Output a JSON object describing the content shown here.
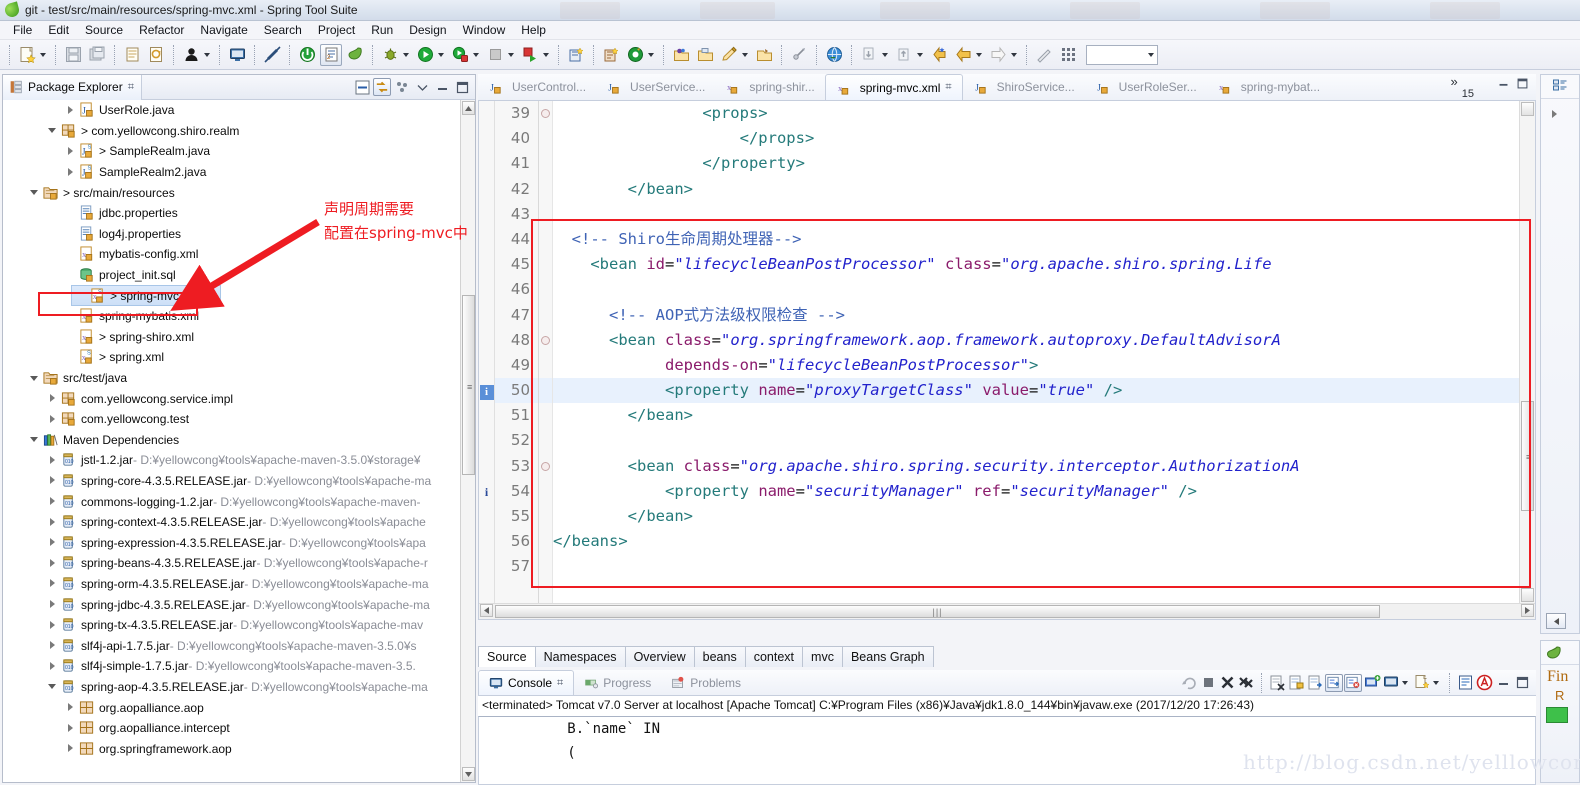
{
  "window": {
    "title": "git - test/src/main/resources/spring-mvc.xml - Spring Tool Suite",
    "app_icon": "sts-leaf-icon"
  },
  "menubar": {
    "items": [
      {
        "label": "File"
      },
      {
        "label": "Edit"
      },
      {
        "label": "Source"
      },
      {
        "label": "Refactor"
      },
      {
        "label": "Navigate"
      },
      {
        "label": "Search"
      },
      {
        "label": "Project"
      },
      {
        "label": "Run"
      },
      {
        "label": "Design"
      },
      {
        "label": "Window"
      },
      {
        "label": "Help"
      }
    ]
  },
  "toolbar": {
    "combo_value": ""
  },
  "package_explorer": {
    "tab_label": "Package Explorer",
    "close_glyph": "⌗",
    "tree": [
      {
        "indent": 3,
        "twisty": "collapsed",
        "icon": "java-file-icon",
        "label": "UserRole.java",
        "path": ""
      },
      {
        "indent": 2,
        "twisty": "expanded",
        "icon": "package-icon",
        "label": "> com.yellowcong.shiro.realm",
        "path": ""
      },
      {
        "indent": 3,
        "twisty": "collapsed",
        "icon": "java-class-icon",
        "label": "> SampleRealm.java",
        "path": ""
      },
      {
        "indent": 3,
        "twisty": "collapsed",
        "icon": "java-class-icon",
        "label": "SampleRealm2.java",
        "path": ""
      },
      {
        "indent": 1,
        "twisty": "expanded",
        "icon": "src-folder-icon",
        "label": "> src/main/resources",
        "path": ""
      },
      {
        "indent": 3,
        "twisty": "none",
        "icon": "props-file-icon",
        "label": "jdbc.properties",
        "path": ""
      },
      {
        "indent": 3,
        "twisty": "none",
        "icon": "props-file-icon",
        "label": "log4j.properties",
        "path": ""
      },
      {
        "indent": 3,
        "twisty": "none",
        "icon": "xml-file-icon",
        "label": "mybatis-config.xml",
        "path": ""
      },
      {
        "indent": 3,
        "twisty": "none",
        "icon": "sql-file-icon",
        "label": "project_init.sql",
        "path": ""
      },
      {
        "indent": 3,
        "twisty": "none",
        "icon": "spring-xml-icon",
        "label": "> spring-mvc.xml",
        "path": "",
        "selected": true
      },
      {
        "indent": 3,
        "twisty": "none",
        "icon": "xml-file-icon",
        "label": "spring-mybatis.xml",
        "path": ""
      },
      {
        "indent": 3,
        "twisty": "none",
        "icon": "xml-file-icon",
        "label": "> spring-shiro.xml",
        "path": ""
      },
      {
        "indent": 3,
        "twisty": "none",
        "icon": "spring-xml-icon",
        "label": "> spring.xml",
        "path": ""
      },
      {
        "indent": 1,
        "twisty": "expanded",
        "icon": "src-folder-icon",
        "label": "src/test/java",
        "path": ""
      },
      {
        "indent": 2,
        "twisty": "collapsed",
        "icon": "package-icon",
        "label": "com.yellowcong.service.impl",
        "path": ""
      },
      {
        "indent": 2,
        "twisty": "collapsed",
        "icon": "package-icon",
        "label": "com.yellowcong.test",
        "path": ""
      },
      {
        "indent": 1,
        "twisty": "expanded",
        "icon": "library-icon",
        "label": "Maven Dependencies",
        "path": ""
      },
      {
        "indent": 2,
        "twisty": "collapsed",
        "icon": "jar-icon",
        "label": "jstl-1.2.jar",
        "path": " - D:¥yellowcong¥tools¥apache-maven-3.5.0¥storage¥"
      },
      {
        "indent": 2,
        "twisty": "collapsed",
        "icon": "jar-icon",
        "label": "spring-core-4.3.5.RELEASE.jar",
        "path": " - D:¥yellowcong¥tools¥apache-ma"
      },
      {
        "indent": 2,
        "twisty": "collapsed",
        "icon": "jar-icon",
        "label": "commons-logging-1.2.jar",
        "path": " - D:¥yellowcong¥tools¥apache-maven-"
      },
      {
        "indent": 2,
        "twisty": "collapsed",
        "icon": "jar-icon",
        "label": "spring-context-4.3.5.RELEASE.jar",
        "path": " - D:¥yellowcong¥tools¥apache"
      },
      {
        "indent": 2,
        "twisty": "collapsed",
        "icon": "jar-icon",
        "label": "spring-expression-4.3.5.RELEASE.jar",
        "path": " - D:¥yellowcong¥tools¥apa"
      },
      {
        "indent": 2,
        "twisty": "collapsed",
        "icon": "jar-icon",
        "label": "spring-beans-4.3.5.RELEASE.jar",
        "path": " - D:¥yellowcong¥tools¥apache-r"
      },
      {
        "indent": 2,
        "twisty": "collapsed",
        "icon": "jar-icon",
        "label": "spring-orm-4.3.5.RELEASE.jar",
        "path": " - D:¥yellowcong¥tools¥apache-ma"
      },
      {
        "indent": 2,
        "twisty": "collapsed",
        "icon": "jar-icon",
        "label": "spring-jdbc-4.3.5.RELEASE.jar",
        "path": " - D:¥yellowcong¥tools¥apache-ma"
      },
      {
        "indent": 2,
        "twisty": "collapsed",
        "icon": "jar-icon",
        "label": "spring-tx-4.3.5.RELEASE.jar",
        "path": " - D:¥yellowcong¥tools¥apache-mav"
      },
      {
        "indent": 2,
        "twisty": "collapsed",
        "icon": "jar-icon",
        "label": "slf4j-api-1.7.5.jar",
        "path": " - D:¥yellowcong¥tools¥apache-maven-3.5.0¥s"
      },
      {
        "indent": 2,
        "twisty": "collapsed",
        "icon": "jar-icon",
        "label": "slf4j-simple-1.7.5.jar",
        "path": " - D:¥yellowcong¥tools¥apache-maven-3.5."
      },
      {
        "indent": 2,
        "twisty": "expanded",
        "icon": "jar-icon",
        "label": "spring-aop-4.3.5.RELEASE.jar",
        "path": " - D:¥yellowcong¥tools¥apache-ma"
      },
      {
        "indent": 3,
        "twisty": "collapsed",
        "icon": "package-plain-icon",
        "label": "org.aopalliance.aop",
        "path": ""
      },
      {
        "indent": 3,
        "twisty": "collapsed",
        "icon": "package-plain-icon",
        "label": "org.aopalliance.intercept",
        "path": ""
      },
      {
        "indent": 3,
        "twisty": "collapsed",
        "icon": "package-plain-icon",
        "label": "org.springframework.aop",
        "path": ""
      }
    ]
  },
  "editor": {
    "tabs": [
      {
        "label": "UserControl...",
        "icon": "java-file-icon",
        "active": false
      },
      {
        "label": "UserService...",
        "icon": "java-file-icon",
        "active": false
      },
      {
        "label": "spring-shir...",
        "icon": "xml-file-icon",
        "active": false
      },
      {
        "label": "spring-mvc.xml",
        "icon": "xml-file-icon",
        "active": true
      },
      {
        "label": "ShiroService...",
        "icon": "java-file-icon",
        "active": false
      },
      {
        "label": "UserRoleSer...",
        "icon": "java-file-icon",
        "active": false
      },
      {
        "label": "spring-mybat...",
        "icon": "xml-file-icon",
        "active": false
      }
    ],
    "overflow_chevron": "»",
    "hidden_tab_count": "15",
    "lines": [
      {
        "num": "39",
        "marker": "fold-collapsed",
        "indent": 8,
        "segments": [
          {
            "t": "tag",
            "s": "<props>"
          }
        ]
      },
      {
        "num": "40",
        "marker": "",
        "indent": 10,
        "segments": [
          {
            "t": "tag",
            "s": "</props>"
          }
        ]
      },
      {
        "num": "41",
        "marker": "",
        "indent": 8,
        "segments": [
          {
            "t": "tag",
            "s": "</property>"
          }
        ]
      },
      {
        "num": "42",
        "marker": "",
        "indent": 4,
        "segments": [
          {
            "t": "tag",
            "s": "</bean>"
          }
        ]
      },
      {
        "num": "43",
        "marker": "",
        "indent": 0,
        "segments": []
      },
      {
        "num": "44",
        "marker": "",
        "indent": 1,
        "segments": [
          {
            "t": "cmt",
            "s": "<!-- Shiro生命周期处理器-->"
          }
        ]
      },
      {
        "num": "45",
        "marker": "",
        "indent": 2,
        "segments": [
          {
            "t": "tag",
            "s": "<bean "
          },
          {
            "t": "attr",
            "s": "id"
          },
          {
            "t": "eq",
            "s": "="
          },
          {
            "t": "val",
            "s": "\"lifecycleBeanPostProcessor\""
          },
          {
            "t": "eq",
            "s": " "
          },
          {
            "t": "attr",
            "s": "class"
          },
          {
            "t": "eq",
            "s": "="
          },
          {
            "t": "val",
            "s": "\"org.apache.shiro.spring.Life"
          }
        ]
      },
      {
        "num": "46",
        "marker": "",
        "indent": 0,
        "segments": []
      },
      {
        "num": "47",
        "marker": "",
        "indent": 3,
        "segments": [
          {
            "t": "cmt",
            "s": "<!-- AOP式方法级权限检查 -->"
          }
        ]
      },
      {
        "num": "48",
        "marker": "fold-collapsed",
        "indent": 3,
        "segments": [
          {
            "t": "tag",
            "s": "<bean "
          },
          {
            "t": "attr",
            "s": "class"
          },
          {
            "t": "eq",
            "s": "="
          },
          {
            "t": "val",
            "s": "\"org.springframework.aop.framework.autoproxy.DefaultAdvisorA"
          }
        ]
      },
      {
        "num": "49",
        "marker": "",
        "indent": 6,
        "segments": [
          {
            "t": "attr",
            "s": "depends-on"
          },
          {
            "t": "eq",
            "s": "="
          },
          {
            "t": "val",
            "s": "\"lifecycleBeanPostProcessor\""
          },
          {
            "t": "tag",
            "s": ">"
          }
        ]
      },
      {
        "num": "50",
        "marker": "quickfix",
        "indent": 6,
        "highlight": true,
        "segments": [
          {
            "t": "tag",
            "s": "<property "
          },
          {
            "t": "attr",
            "s": "name"
          },
          {
            "t": "eq",
            "s": "="
          },
          {
            "t": "val",
            "s": "\"proxyTargetClass\""
          },
          {
            "t": "eq",
            "s": " "
          },
          {
            "t": "attr",
            "s": "value"
          },
          {
            "t": "eq",
            "s": "="
          },
          {
            "t": "val",
            "s": "\"true\""
          },
          {
            "t": "tag",
            "s": " />"
          }
        ]
      },
      {
        "num": "51",
        "marker": "",
        "indent": 4,
        "segments": [
          {
            "t": "tag",
            "s": "</bean>"
          }
        ]
      },
      {
        "num": "52",
        "marker": "",
        "indent": 0,
        "segments": []
      },
      {
        "num": "53",
        "marker": "fold-collapsed",
        "indent": 4,
        "segments": [
          {
            "t": "tag",
            "s": "<bean "
          },
          {
            "t": "attr",
            "s": "class"
          },
          {
            "t": "eq",
            "s": "="
          },
          {
            "t": "val",
            "s": "\"org.apache.shiro.spring.security.interceptor.AuthorizationA"
          }
        ]
      },
      {
        "num": "54",
        "marker": "info",
        "indent": 6,
        "segments": [
          {
            "t": "tag",
            "s": "<property "
          },
          {
            "t": "attr",
            "s": "name"
          },
          {
            "t": "eq",
            "s": "="
          },
          {
            "t": "val",
            "s": "\"securityManager\""
          },
          {
            "t": "eq",
            "s": " "
          },
          {
            "t": "attr",
            "s": "ref"
          },
          {
            "t": "eq",
            "s": "="
          },
          {
            "t": "val",
            "s": "\"securityManager\""
          },
          {
            "t": "tag",
            "s": " />"
          }
        ]
      },
      {
        "num": "55",
        "marker": "",
        "indent": 4,
        "segments": [
          {
            "t": "tag",
            "s": "</bean>"
          }
        ]
      },
      {
        "num": "56",
        "marker": "",
        "indent": 0,
        "segments": [
          {
            "t": "tag",
            "s": "</beans>"
          }
        ]
      },
      {
        "num": "57",
        "marker": "",
        "indent": 0,
        "segments": []
      }
    ],
    "source_tabs": [
      {
        "label": "Source",
        "active": true
      },
      {
        "label": "Namespaces",
        "active": false
      },
      {
        "label": "Overview",
        "active": false
      },
      {
        "label": "beans",
        "active": false
      },
      {
        "label": "context",
        "active": false
      },
      {
        "label": "mvc",
        "active": false
      },
      {
        "label": "Beans Graph",
        "active": false
      }
    ]
  },
  "console": {
    "tabs": [
      {
        "label": "Console",
        "icon": "console-icon",
        "active": true,
        "close_glyph": "⌗"
      },
      {
        "label": "Progress",
        "icon": "progress-icon",
        "active": false
      },
      {
        "label": "Problems",
        "icon": "problems-icon",
        "active": false
      }
    ],
    "header": "<terminated> Tomcat v7.0 Server at localhost [Apache Tomcat] C:¥Program Files (x86)¥Java¥jdk1.8.0_144¥bin¥javaw.exe (2017/12/20 17:26:43)",
    "body_lines": [
      "          B.`name` IN",
      "          ("
    ]
  },
  "right_panel": {
    "outline_icon": "outline-icon",
    "find_label": "Fin",
    "sub_label": "R"
  },
  "annotations": {
    "note_line1": "声明周期需要",
    "note_line2": "配置在spring-mvc中",
    "color": "#ee1c22"
  },
  "watermark": {
    "text": "http://blog.csdn.net/yelllowcong"
  }
}
